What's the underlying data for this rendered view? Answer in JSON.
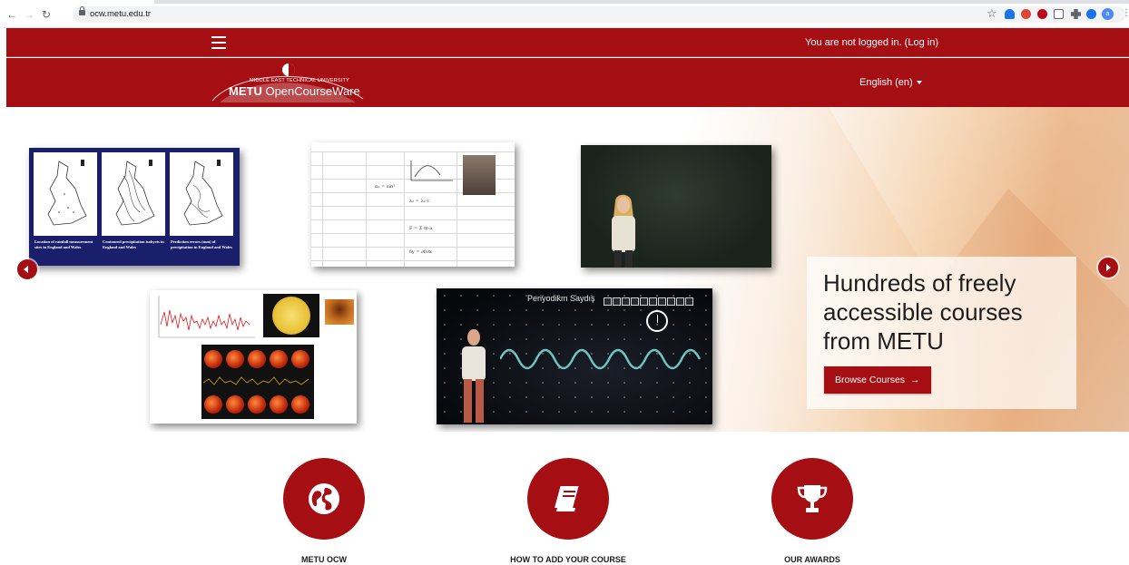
{
  "browser": {
    "url": "ocw.metu.edu.tr",
    "back_icon": "arrow-left",
    "forward_icon": "arrow-right",
    "reload_icon": "reload",
    "extension_colors": [
      "#1a73e8",
      "#db4437",
      "#bd081c",
      "#5f6368",
      "#5f6368",
      "#1a73e8"
    ]
  },
  "topbar": {
    "login_text": "You are not logged in. (Log in)",
    "menu_icon": "hamburger"
  },
  "brand": {
    "logo_top": "MIDDLE EAST TECHNICAL UNIVERSITY",
    "logo_main_bold": "METU",
    "logo_main_rest": " OpenCourseWare",
    "language": "English (en)"
  },
  "hero": {
    "caption": "Hundreds of freely accessible courses from METU",
    "button_label": "Browse Courses",
    "button_arrow": "→",
    "map_captions": [
      "Location of rainfall measurement sites in England and Wales",
      "Contoured precipitation isohyets in England and Wales",
      "Prediction errors (mm) of precipitation in England and Wales"
    ],
    "sheet_text": [
      "α₁ = sin²",
      "λ₂ = λ₁·τ",
      "F = Σ m·a",
      "δy = ∂f/∂x"
    ],
    "physics_title": "Periyodikm Saydış"
  },
  "features": [
    {
      "label": "METU OCW",
      "icon": "globe-icon"
    },
    {
      "label": "HOW TO ADD YOUR COURSE",
      "icon": "book-icon"
    },
    {
      "label": "OUR AWARDS",
      "icon": "trophy-icon"
    }
  ],
  "colors": {
    "brand_red": "#a50e12",
    "hero_accent": "#eab385"
  }
}
